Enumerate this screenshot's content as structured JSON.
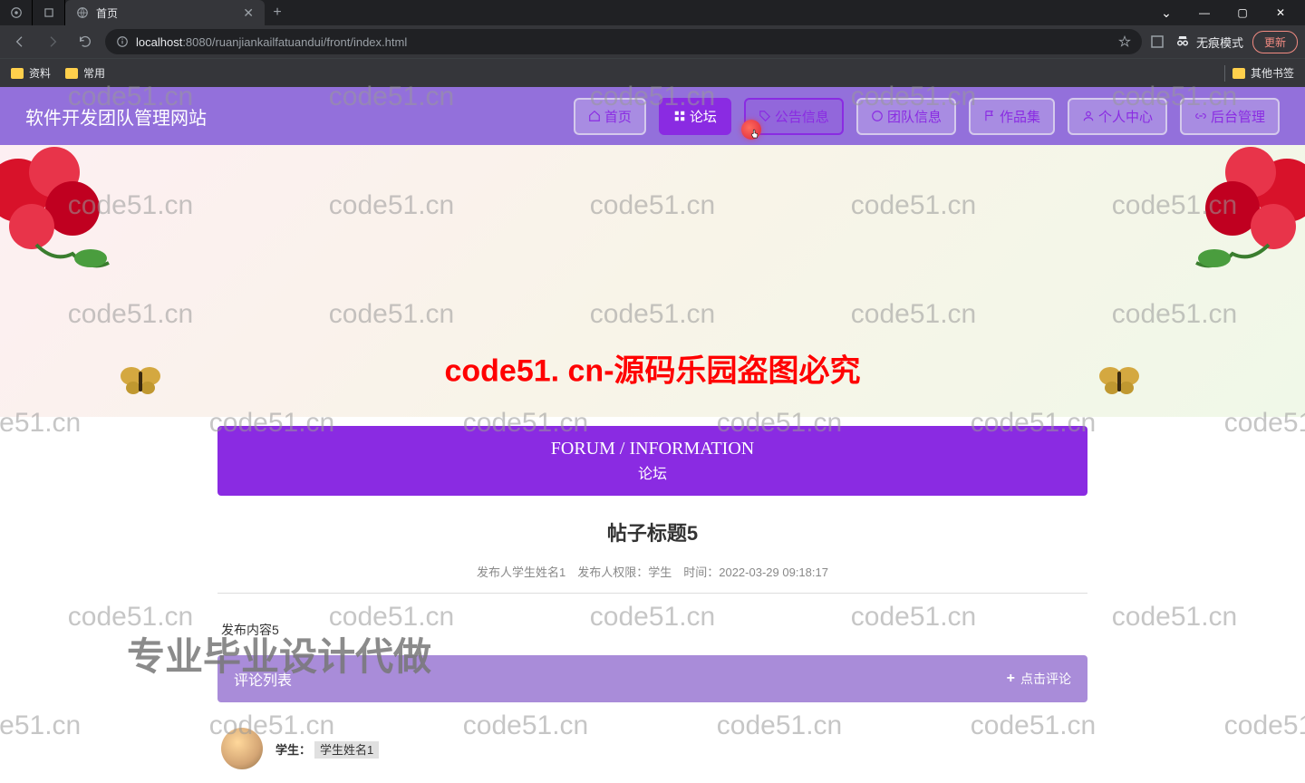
{
  "browser": {
    "tab_title": "首页",
    "tab_new": "+",
    "url_host": "localhost",
    "url_port": ":8080",
    "url_path": "/ruanjiankailfatuandui/front/index.html",
    "incognito_label": "无痕模式",
    "update_btn": "更新",
    "win_chevron": "⌄",
    "win_min": "—",
    "win_max": "▢",
    "win_close": "✕",
    "tab_close": "✕"
  },
  "bookmarks": {
    "b1": "资料",
    "b2": "常用",
    "other": "其他书签"
  },
  "site": {
    "title": "软件开发团队管理网站"
  },
  "nav": {
    "home": "首页",
    "forum": "论坛",
    "announce": "公告信息",
    "team": "团队信息",
    "works": "作品集",
    "personal": "个人中心",
    "admin": "后台管理"
  },
  "banner": {
    "overlay": "code51. cn-源码乐园盗图必究"
  },
  "section": {
    "en": "FORUM / INFORMATION",
    "cn": "论坛"
  },
  "post": {
    "title": "帖子标题5",
    "meta": "发布人学生姓名1　发布人权限：学生　时间：2022-03-29 09:18:17",
    "body": "发布内容5"
  },
  "comments": {
    "bar_title": "评论列表",
    "btn": "点击评论",
    "plus": "+",
    "first_role": "学生：",
    "first_name": "学生姓名1"
  },
  "watermark": {
    "text": "code51.cn",
    "big": "专业毕业设计代做"
  }
}
